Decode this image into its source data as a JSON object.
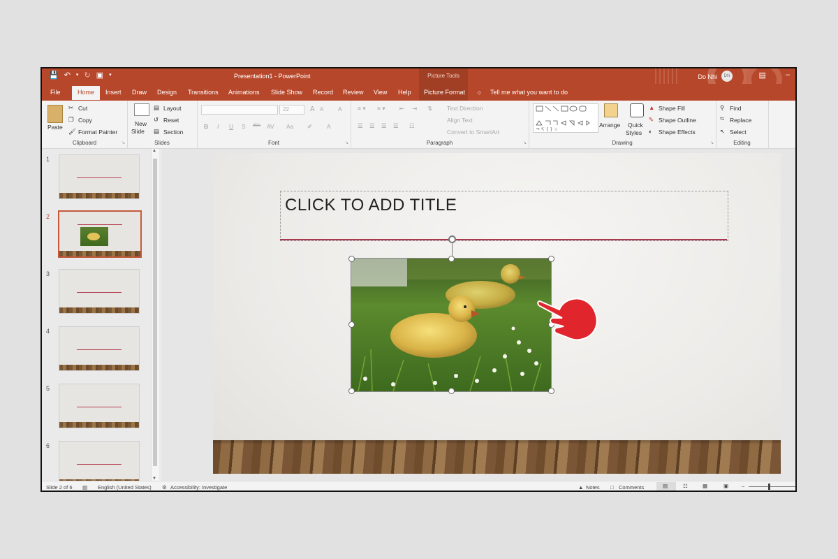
{
  "titlebar": {
    "title": "Presentation1  -  PowerPoint",
    "context_group": "Picture Tools",
    "user_name": "Do Nhi",
    "user_initials": "DN"
  },
  "tabs": [
    "File",
    "Home",
    "Insert",
    "Draw",
    "Design",
    "Transitions",
    "Animations",
    "Slide Show",
    "Record",
    "Review",
    "View",
    "Help",
    "Picture Format"
  ],
  "active_tab": "Home",
  "tell_me": "Tell me what you want to do",
  "ribbon": {
    "clipboard": {
      "paste": "Paste",
      "cut": "Cut",
      "copy": "Copy",
      "format_painter": "Format Painter",
      "label": "Clipboard"
    },
    "slides": {
      "new_slide_1": "New",
      "new_slide_2": "Slide",
      "layout": "Layout",
      "reset": "Reset",
      "section": "Section",
      "label": "Slides"
    },
    "font": {
      "size": "22",
      "label": "Font",
      "bold": "B",
      "italic": "I",
      "underline": "U",
      "shadow": "S",
      "strike": "abc",
      "spacing": "AV",
      "case": "Aa",
      "grow": "A",
      "shrink": "A",
      "clear": "A",
      "color": "A"
    },
    "paragraph": {
      "text_direction": "Text Direction",
      "align_text": "Align Text",
      "convert": "Convert to SmartArt",
      "label": "Paragraph"
    },
    "drawing": {
      "arrange": "Arrange",
      "quick_styles_1": "Quick",
      "quick_styles_2": "Styles",
      "shape_fill": "Shape Fill",
      "shape_outline": "Shape Outline",
      "shape_effects": "Shape Effects",
      "label": "Drawing"
    },
    "editing": {
      "find": "Find",
      "replace": "Replace",
      "select": "Select",
      "label": "Editing"
    }
  },
  "thumbnails": [
    {
      "num": "1",
      "has_picture": false
    },
    {
      "num": "2",
      "has_picture": true
    },
    {
      "num": "3",
      "has_picture": false
    },
    {
      "num": "4",
      "has_picture": false
    },
    {
      "num": "5",
      "has_picture": false
    },
    {
      "num": "6",
      "has_picture": false
    }
  ],
  "selected_slide": 2,
  "slide": {
    "title_placeholder": "CLICK TO ADD TITLE"
  },
  "status": {
    "slide_count": "Slide 2 of 6",
    "language": "English (United States)",
    "accessibility": "Accessibility: Investigate",
    "notes": "Notes",
    "comments": "Comments"
  },
  "colors": {
    "accent": "#b7472a",
    "title_line": "#a83a4f",
    "hand": "#e0262c"
  }
}
